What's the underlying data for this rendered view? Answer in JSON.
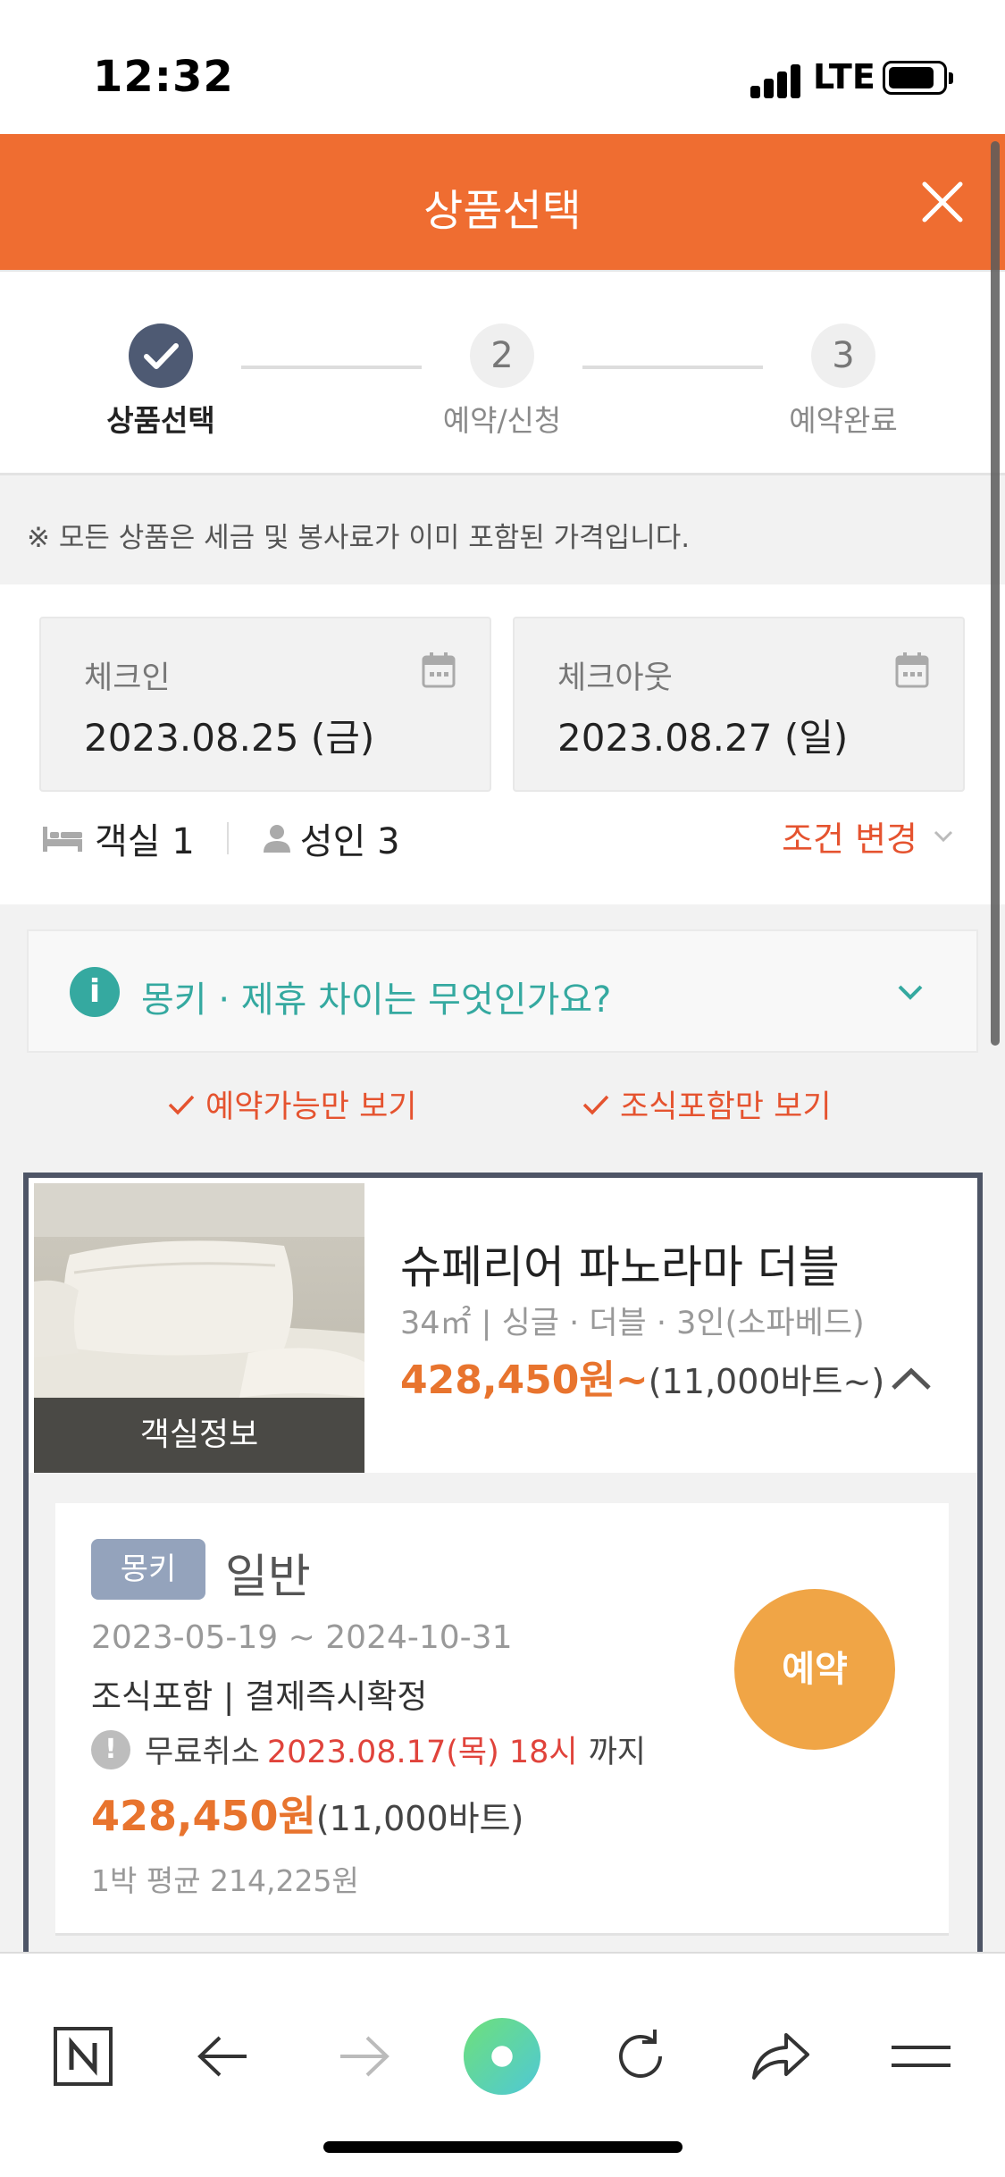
{
  "status_bar": {
    "time": "12:32",
    "network": "LTE"
  },
  "header": {
    "title": "상품선택"
  },
  "steps": [
    {
      "number": "1",
      "label": "상품선택"
    },
    {
      "number": "2",
      "label": "예약/신청"
    },
    {
      "number": "3",
      "label": "예약완료"
    }
  ],
  "notice": {
    "text": "※ 모든 상품은 세금 및 봉사료가 이미 포함된 가격입니다."
  },
  "dates": {
    "checkin_label": "체크인",
    "checkin_value": "2023.08.25 (금)",
    "checkout_label": "체크아웃",
    "checkout_value": "2023.08.27 (일)"
  },
  "guests": {
    "rooms": "객실 1",
    "adults": "성인 3",
    "change_label": "조건 변경"
  },
  "info_bar": {
    "text": "몽키 · 제휴 차이는 무엇인가요?"
  },
  "filters": [
    {
      "label": "예약가능만 보기"
    },
    {
      "label": "조식포함만 보기"
    }
  ],
  "room": {
    "photo_label": "객실정보",
    "name": "슈페리어 파노라마 더블",
    "spec": "34㎡ | 싱글 · 더블 · 3인(소파베드)",
    "price": "428,450원~",
    "price_sub": "(11,000바트~)"
  },
  "rate": {
    "badge": "몽키",
    "type": "일반",
    "period": "2023-05-19 ~ 2024-10-31",
    "conditions": "조식포함 | 결제즉시확정",
    "cancel_prefix": "무료취소",
    "cancel_date": "2023.08.17(목) 18시",
    "cancel_suffix": "까지",
    "price": "428,450원",
    "price_sub": "(11,000바트)",
    "average": "1박 평균 214,225원",
    "book_label": "예약"
  },
  "colors": {
    "brand": "#ef6d31",
    "price": "#e8742e",
    "accent_red": "#e5532f",
    "teal": "#35a9a0",
    "book": "#f0a546"
  },
  "icons": [
    "close-icon",
    "check-icon",
    "calendar-icon",
    "bed-icon",
    "person-icon",
    "chevron-down-icon",
    "info-icon",
    "chevron-up-icon",
    "warning-icon",
    "n-logo-icon",
    "back-arrow-icon",
    "forward-arrow-icon",
    "home-dot-icon",
    "refresh-icon",
    "share-icon",
    "menu-icon"
  ]
}
